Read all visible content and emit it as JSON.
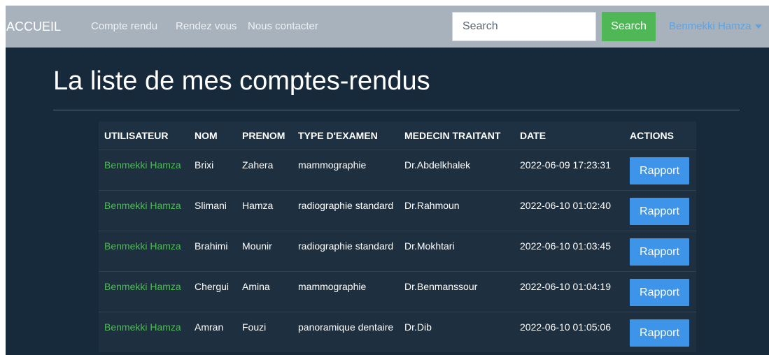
{
  "navbar": {
    "brand": "ACCUEIL",
    "links": [
      "Compte rendu",
      "Rendez vous",
      "Nous contacter"
    ],
    "search": {
      "placeholder": "Search",
      "value": "",
      "button_label": "Search"
    },
    "user": "Benmekki Hamza"
  },
  "page": {
    "title": "La liste de mes comptes-rendus"
  },
  "table": {
    "headers": [
      "UTILISATEUR",
      "NOM",
      "PRENOM",
      "TYPE D'EXAMEN",
      "MEDECIN TRAITANT",
      "DATE",
      "ACTIONS"
    ],
    "rows": [
      {
        "user": "Benmekki Hamza",
        "nom": "Brixi",
        "prenom": "Zahera",
        "type": "mammographie",
        "medecin": "Dr.Abdelkhalek",
        "date": "2022-06-09 17:23:31",
        "action": "Rapport"
      },
      {
        "user": "Benmekki Hamza",
        "nom": "Slimani",
        "prenom": "Hamza",
        "type": "radiographie standard",
        "medecin": "Dr.Rahmoun",
        "date": "2022-06-10 01:02:40",
        "action": "Rapport"
      },
      {
        "user": "Benmekki Hamza",
        "nom": "Brahimi",
        "prenom": "Mounir",
        "type": "radiographie standard",
        "medecin": "Dr.Mokhtari",
        "date": "2022-06-10 01:03:45",
        "action": "Rapport"
      },
      {
        "user": "Benmekki Hamza",
        "nom": "Chergui",
        "prenom": "Amina",
        "type": "mammographie",
        "medecin": "Dr.Benmanssour",
        "date": "2022-06-10 01:04:19",
        "action": "Rapport"
      },
      {
        "user": "Benmekki Hamza",
        "nom": "Amran",
        "prenom": "Fouzi",
        "type": "panoramique dentaire",
        "medecin": "Dr.Dib",
        "date": "2022-06-10 01:05:06",
        "action": "Rapport"
      }
    ]
  },
  "colors": {
    "navbar_bg": "#a8b2bd",
    "page_bg": "#172a3b",
    "search_button": "#4fb756",
    "user_link": "#5aa4e6",
    "user_cell": "#4fbb55",
    "action_button": "#3d94e8"
  }
}
